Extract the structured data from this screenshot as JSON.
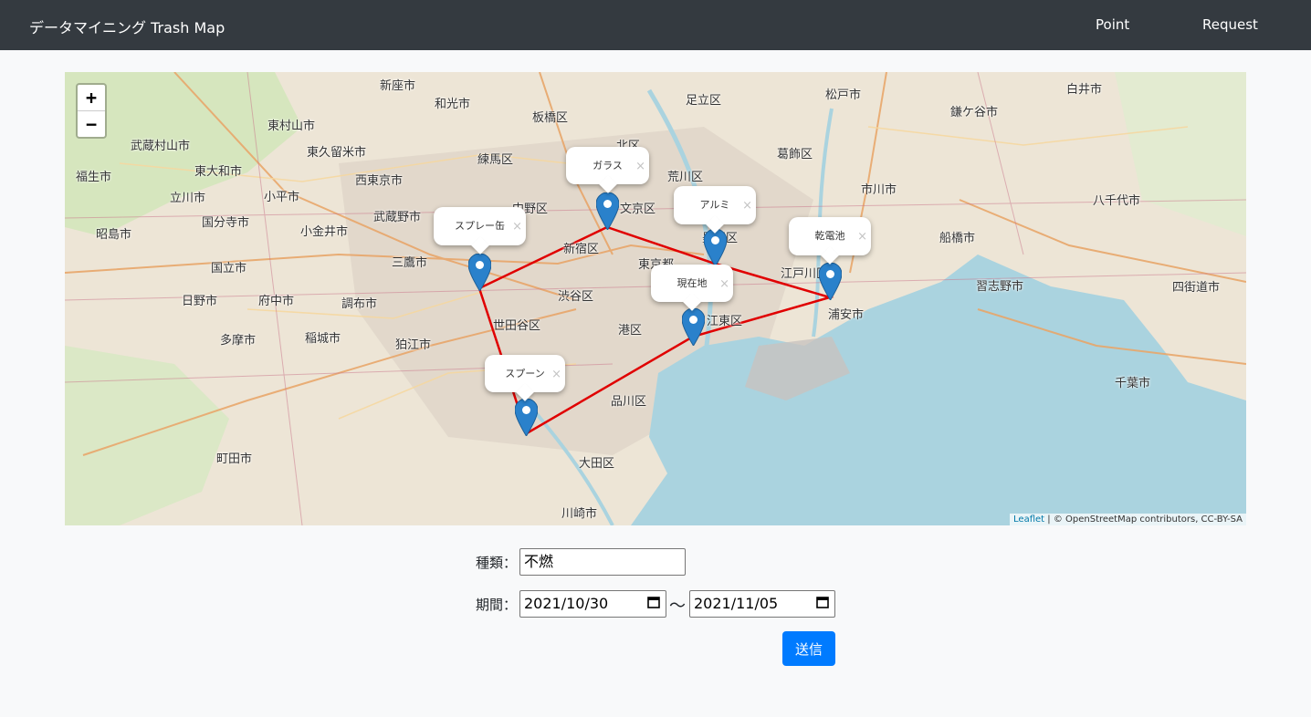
{
  "navbar": {
    "brand": "データマイニング Trash Map",
    "links": [
      "Point",
      "Request"
    ]
  },
  "map": {
    "zoom_in": "+",
    "zoom_out": "−",
    "attribution": {
      "leaflet": "Leaflet",
      "text": "| © OpenStreetMap contributors, CC-BY-SA"
    },
    "markers": [
      {
        "label": "ガラス"
      },
      {
        "label": "アルミ"
      },
      {
        "label": "スプレー缶"
      },
      {
        "label": "乾電池"
      },
      {
        "label": "現在地"
      },
      {
        "label": "スプーン"
      }
    ],
    "popup_close": "×",
    "route_color": "#e00000",
    "marker_color": "#2a81cb",
    "place_names": [
      "新座市",
      "和光市",
      "板橋区",
      "足立区",
      "松戸市",
      "白井市",
      "鎌ケ谷市",
      "東村山市",
      "武蔵村山市",
      "東久留米市",
      "練馬区",
      "北区",
      "葛飾区",
      "東大和市",
      "西東京市",
      "荒川区",
      "市川市",
      "八千代市",
      "福生市",
      "立川市",
      "小平市",
      "中野区",
      "文京区",
      "国分寺市",
      "武蔵野市",
      "小金井市",
      "新宿区",
      "墨田区",
      "船橋市",
      "昭島市",
      "三鷹市",
      "江戸川区",
      "国立市",
      "東京都",
      "習志野市",
      "四街道市",
      "日野市",
      "府中市",
      "調布市",
      "渋谷区",
      "江東区",
      "浦安市",
      "世田谷区",
      "港区",
      "多摩市",
      "稲城市",
      "狛江市",
      "品川区",
      "千葉市",
      "町田市",
      "大田区",
      "川崎市"
    ]
  },
  "form": {
    "type_label": "種類：",
    "type_value": "不燃",
    "period_label": "期間：",
    "date_from": "2021/10/30",
    "date_to": "2021/11/05",
    "separator": "〜",
    "submit": "送信"
  },
  "colors": {
    "navbar": "#343a40",
    "button": "#007bff",
    "water": "#aad3df",
    "land": "#ede5d6"
  }
}
